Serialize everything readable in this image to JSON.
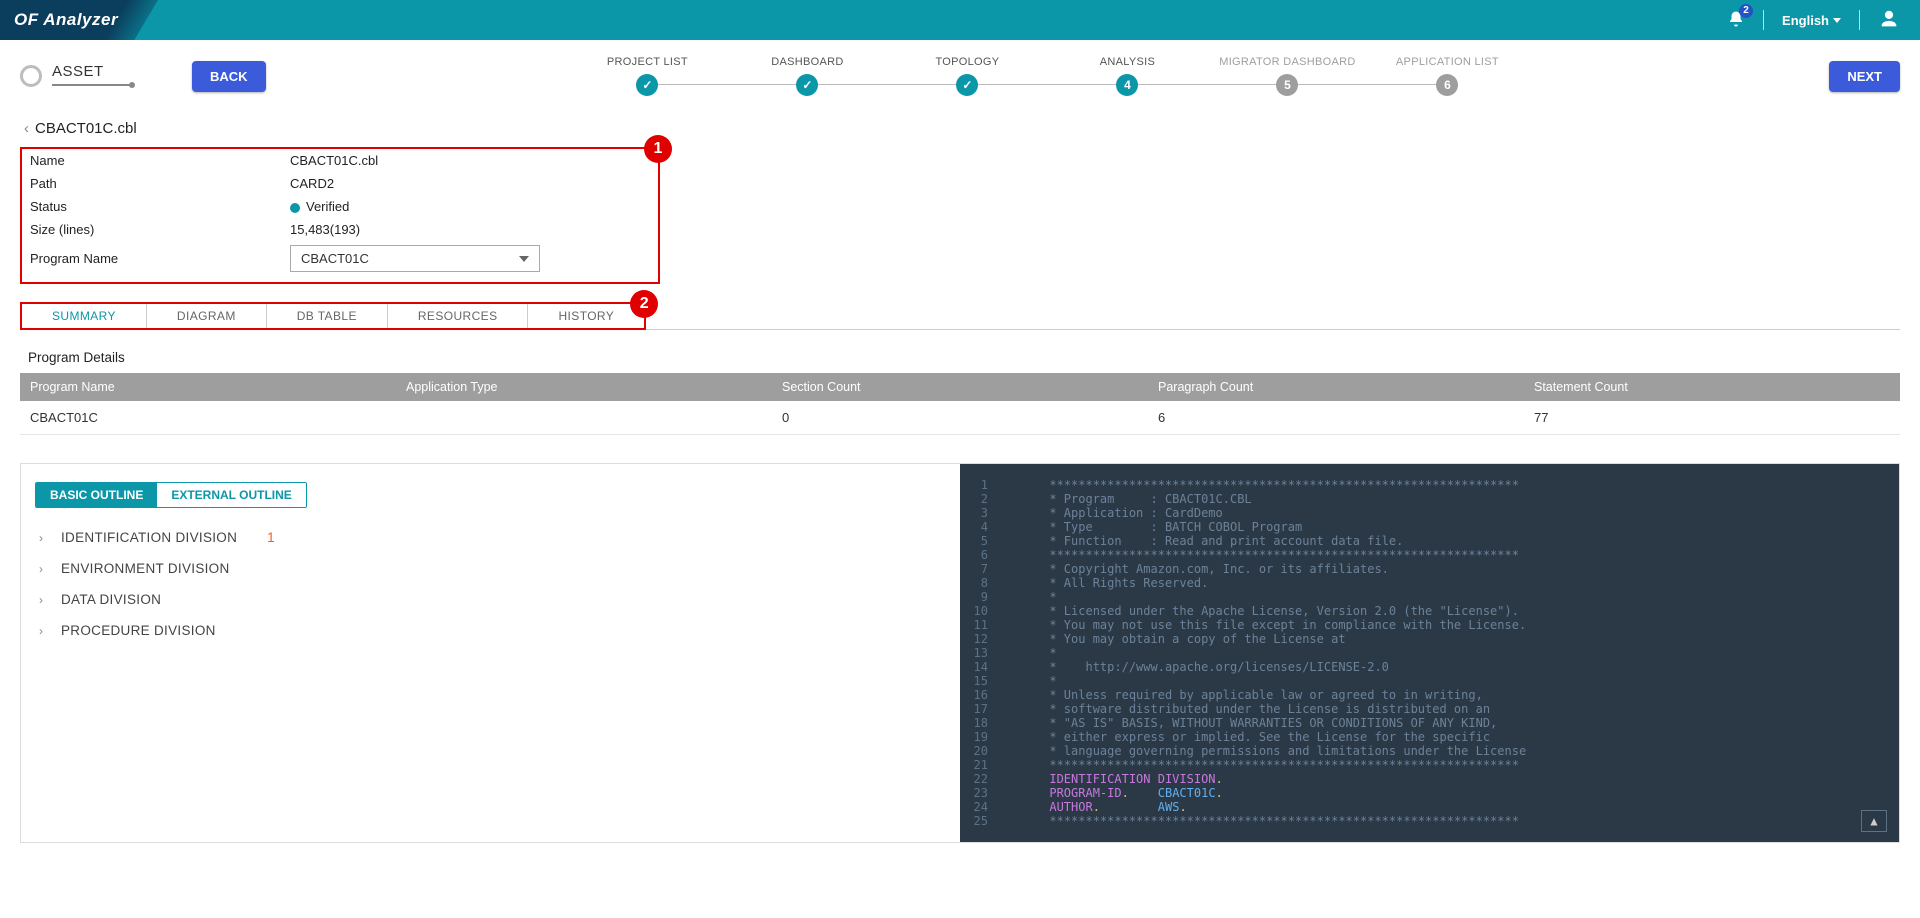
{
  "header": {
    "brand": "OF Analyzer",
    "notif_count": "2",
    "language": "English"
  },
  "stepper": {
    "asset_label": "ASSET",
    "back": "BACK",
    "next": "NEXT",
    "steps": [
      {
        "label": "PROJECT LIST",
        "state": "done"
      },
      {
        "label": "DASHBOARD",
        "state": "done"
      },
      {
        "label": "TOPOLOGY",
        "state": "done"
      },
      {
        "label": "ANALYSIS",
        "state": "current",
        "num": "4"
      },
      {
        "label": "MIGRATOR DASHBOARD",
        "state": "pending",
        "num": "5"
      },
      {
        "label": "APPLICATION LIST",
        "state": "pending",
        "num": "6"
      }
    ]
  },
  "crumb": {
    "title": "CBACT01C.cbl"
  },
  "details": {
    "rows": {
      "name_k": "Name",
      "name_v": "CBACT01C.cbl",
      "path_k": "Path",
      "path_v": "CARD2",
      "status_k": "Status",
      "status_v": "Verified",
      "size_k": "Size (lines)",
      "size_v": "15,483(193)",
      "prog_k": "Program Name",
      "prog_v": "CBACT01C"
    }
  },
  "callouts": {
    "one": "1",
    "two": "2"
  },
  "subtabs": {
    "summary": "SUMMARY",
    "diagram": "DIAGRAM",
    "dbtable": "DB TABLE",
    "resources": "RESOURCES",
    "history": "HISTORY"
  },
  "progdetails": {
    "title": "Program Details",
    "headers": {
      "pn": "Program Name",
      "at": "Application Type",
      "sc": "Section Count",
      "pc": "Paragraph Count",
      "stc": "Statement Count"
    },
    "row": {
      "pn": "CBACT01C",
      "at": "",
      "sc": "0",
      "pc": "6",
      "stc": "77"
    }
  },
  "outline": {
    "tab_basic": "BASIC OUTLINE",
    "tab_external": "EXTERNAL OUTLINE",
    "items": {
      "id_div": "IDENTIFICATION DIVISION",
      "id_count": "1",
      "env_div": "ENVIRONMENT DIVISION",
      "data_div": "DATA DIVISION",
      "proc_div": "PROCEDURE DIVISION"
    }
  },
  "code": {
    "l1": "      *****************************************************************",
    "l2": "      * Program     : CBACT01C.CBL",
    "l3": "      * Application : CardDemo",
    "l4": "      * Type        : BATCH COBOL Program",
    "l5": "      * Function    : Read and print account data file.",
    "l6": "      *****************************************************************",
    "l7": "      * Copyright Amazon.com, Inc. or its affiliates.",
    "l8": "      * All Rights Reserved.",
    "l9": "      *",
    "l10": "      * Licensed under the Apache License, Version 2.0 (the \"License\").",
    "l11": "      * You may not use this file except in compliance with the License.",
    "l12": "      * You may obtain a copy of the License at",
    "l13": "      *",
    "l14": "      *    http://www.apache.org/licenses/LICENSE-2.0",
    "l15": "      *",
    "l16": "      * Unless required by applicable law or agreed to in writing,",
    "l17": "      * software distributed under the License is distributed on an",
    "l18": "      * \"AS IS\" BASIS, WITHOUT WARRANTIES OR CONDITIONS OF ANY KIND,",
    "l19": "      * either express or implied. See the License for the specific",
    "l20": "      * language governing permissions and limitations under the License",
    "l21": "      *****************************************************************",
    "l22_kw": "IDENTIFICATION DIVISION",
    "l23_kw": "PROGRAM-ID",
    "l23_val": "CBACT01C",
    "l24_kw": "AUTHOR",
    "l24_val": "AWS",
    "l25": "      *****************************************************************"
  }
}
